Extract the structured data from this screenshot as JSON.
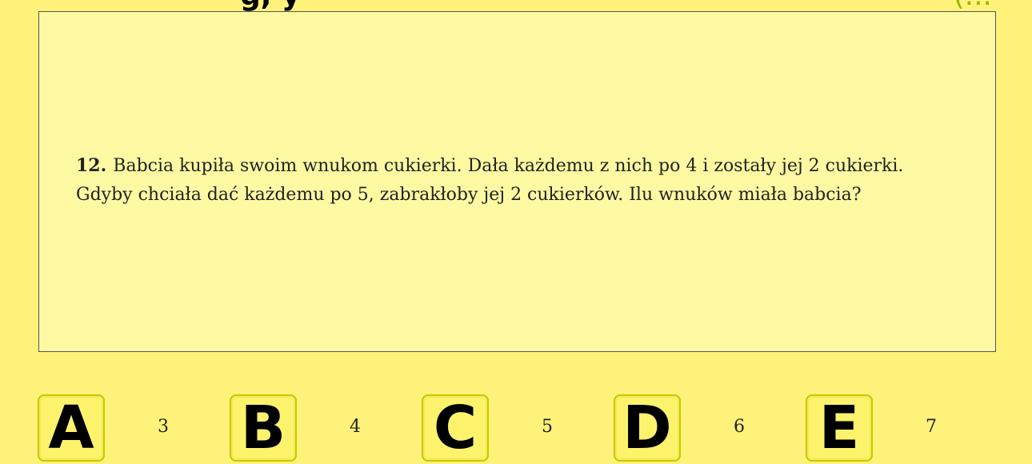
{
  "header": {
    "title_fragment": "g, y",
    "right_fragment": "(..."
  },
  "question": {
    "number": "12.",
    "line1": "Babcia kupiła swoim wnukom cukierki. Dała każdemu z nich po 4 i zostały jej 2 cukierki.",
    "line2": "Gdyby chciała dać każdemu po 5, zabrakłoby jej 2 cukierków. Ilu wnuków miała babcia?"
  },
  "answers": [
    {
      "letter": "A",
      "value": "3"
    },
    {
      "letter": "B",
      "value": "4"
    },
    {
      "letter": "C",
      "value": "5"
    },
    {
      "letter": "D",
      "value": "6"
    },
    {
      "letter": "E",
      "value": "7"
    }
  ],
  "colors": {
    "background": "#fff27a",
    "panel": "#fdf9a2",
    "tile": "#fcf26c",
    "tile_border": "#c6c800"
  }
}
